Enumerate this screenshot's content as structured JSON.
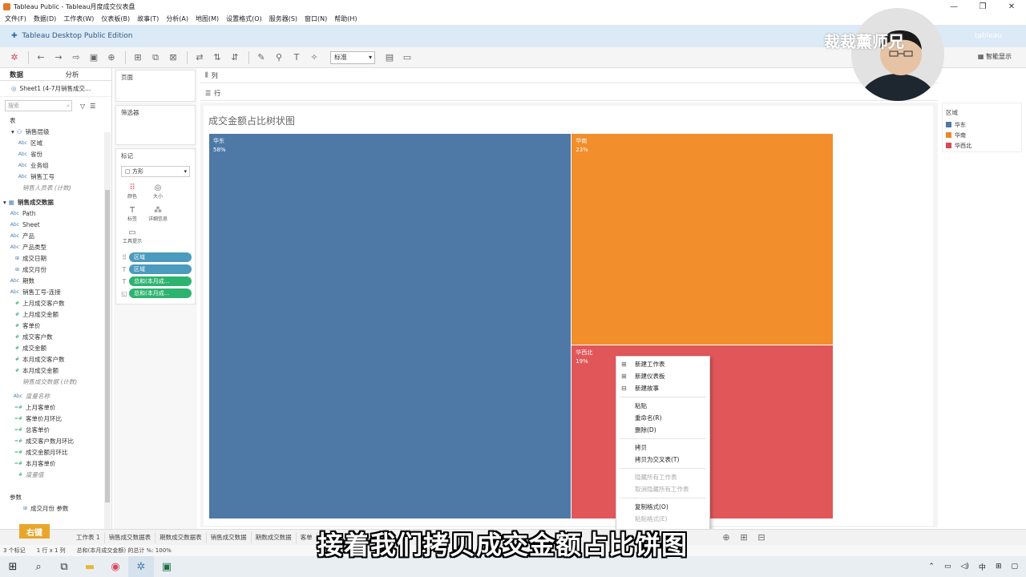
{
  "window": {
    "title": "Tableau Public - Tableau月度成交仪表盘",
    "controls": [
      "—",
      "❐",
      "✕"
    ]
  },
  "menu": [
    "文件(F)",
    "数据(D)",
    "工作表(W)",
    "仪表板(B)",
    "故事(T)",
    "分析(A)",
    "地图(M)",
    "设置格式(O)",
    "服务器(S)",
    "窗口(N)",
    "帮助(H)"
  ],
  "edition": {
    "label": "Tableau Desktop Public Edition",
    "brand": "tableau"
  },
  "toolbar": {
    "fit_select": "标准",
    "smart_show": "智能显示"
  },
  "data_pane": {
    "tabs": [
      "数据",
      "分析"
    ],
    "datasource": "Sheet1 (4-7月销售成交...",
    "search_placeholder": "搜索",
    "section_table": "表",
    "hierarchy": "销售层级",
    "hierarchy_fields": [
      {
        "type": "Abc",
        "name": "区域"
      },
      {
        "type": "Abc",
        "name": "省份"
      },
      {
        "type": "Abc",
        "name": "业务组"
      },
      {
        "type": "Abc",
        "name": "销售工号"
      }
    ],
    "count_field_1": "销售人员表 (计数)",
    "table2": "销售成交数据",
    "table2_fields": [
      {
        "type": "Abc",
        "name": "Path"
      },
      {
        "type": "Abc",
        "name": "Sheet"
      },
      {
        "type": "Abc",
        "name": "产品"
      },
      {
        "type": "Abc",
        "name": "产品类型"
      },
      {
        "type": "⊞",
        "name": "成交日期"
      },
      {
        "type": "⊞",
        "name": "成交月份"
      },
      {
        "type": "Abc",
        "name": "期数"
      },
      {
        "type": "Abc",
        "name": "销售工号-连接"
      },
      {
        "type": "#",
        "name": "上月成交客户数"
      },
      {
        "type": "#",
        "name": "上月成交金额"
      },
      {
        "type": "#",
        "name": "客单价"
      },
      {
        "type": "#",
        "name": "成交客户数"
      },
      {
        "type": "#",
        "name": "成交金额"
      },
      {
        "type": "#",
        "name": "本月成交客户数"
      },
      {
        "type": "#",
        "name": "本月成交金额"
      }
    ],
    "count_field_2": "销售成交数据 (计数)",
    "measure_names": "度量名称",
    "calc_fields": [
      "上月客单价",
      "客单价月环比",
      "总客单价",
      "成交客户数月环比",
      "成交金额月环比",
      "本月客单价"
    ],
    "measure_values": "度量值",
    "params_header": "参数",
    "param": "成交月份 参数"
  },
  "shelves": {
    "pages": "页面",
    "filters": "筛选器",
    "marks": "标记",
    "mark_type": "方形",
    "mark_buttons": [
      "颜色",
      "大小",
      "标签",
      "详细信息",
      "工具提示"
    ],
    "pills": [
      {
        "icon": "⠿",
        "label": "区域",
        "color": "blue"
      },
      {
        "icon": "T",
        "label": "区域",
        "color": "blue"
      },
      {
        "icon": "T",
        "label": "总和(本月成...",
        "color": "green"
      },
      {
        "icon": "◱",
        "label": "总和(本月成...",
        "color": "green"
      }
    ],
    "columns": "列",
    "rows": "行"
  },
  "viz": {
    "title": "成交金额占比树状图"
  },
  "chart_data": {
    "type": "treemap",
    "title": "成交金额占比树状图",
    "categories": [
      "华东",
      "华南",
      "华西北"
    ],
    "values": [
      58,
      23,
      19
    ],
    "labels": [
      "58%",
      "23%",
      "19%"
    ],
    "colors": [
      "#4e79a7",
      "#f28e2b",
      "#e15759"
    ],
    "legend_title": "区域"
  },
  "legend": {
    "title": "区域",
    "items": [
      {
        "label": "华东",
        "color": "#4e79a7"
      },
      {
        "label": "华南",
        "color": "#e8892c"
      },
      {
        "label": "华西北",
        "color": "#d6495a"
      }
    ]
  },
  "context_menu": {
    "groups": [
      [
        {
          "label": "新建工作表",
          "icon": "⊞",
          "disabled": false
        },
        {
          "label": "新建仪表板",
          "icon": "⊞",
          "disabled": false
        },
        {
          "label": "新建故事",
          "icon": "⊟",
          "disabled": false
        }
      ],
      [
        {
          "label": "粘贴",
          "icon": "",
          "disabled": false
        },
        {
          "label": "重命名(R)",
          "icon": "",
          "disabled": false
        },
        {
          "label": "删除(D)",
          "icon": "",
          "disabled": false
        }
      ],
      [
        {
          "label": "拷贝",
          "icon": "",
          "disabled": false
        },
        {
          "label": "拷贝为交叉表(T)",
          "icon": "",
          "disabled": false
        }
      ],
      [
        {
          "label": "隐藏所有工作表",
          "icon": "",
          "disabled": true
        },
        {
          "label": "取消隐藏所有工作表",
          "icon": "",
          "disabled": true
        }
      ],
      [
        {
          "label": "复制格式(O)",
          "icon": "",
          "disabled": false
        },
        {
          "label": "粘贴格式(E)",
          "icon": "",
          "disabled": true
        }
      ]
    ]
  },
  "sheet_tabs": [
    "工作表 1",
    "销售成交数据表",
    "期数成交数据表",
    "销售成交数据",
    "期数成交数据",
    "客单"
  ],
  "status": {
    "marks": "3 个标记",
    "rows_cols": "1 行 x 1 列",
    "sum": "总和(本月成交金额) 的总计 %: 100%"
  },
  "taskbar": {
    "ime": "中"
  },
  "overlay": {
    "badge": "右键",
    "subtitle": "接着我们拷贝成交金额占比饼图",
    "watermark": "裁裁薰师兄"
  }
}
